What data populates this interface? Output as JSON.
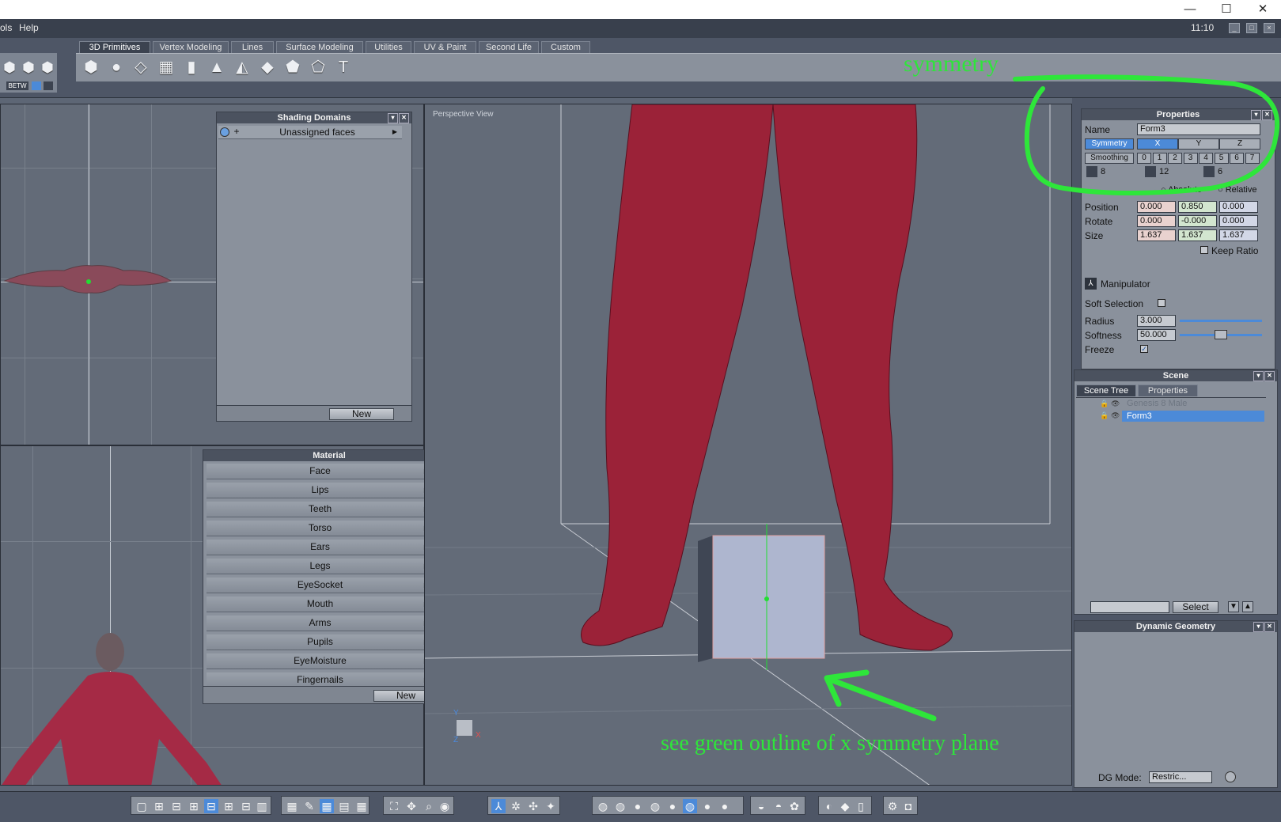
{
  "window": {
    "minimize": "—",
    "maximize": "☐",
    "close": "✕"
  },
  "menubar": {
    "items": [
      "ols",
      "Help"
    ],
    "clock": "11:10"
  },
  "tabs": [
    "3D Primitives",
    "Vertex Modeling",
    "Lines",
    "Surface Modeling",
    "Utilities",
    "UV & Paint",
    "Second Life",
    "Custom"
  ],
  "left_mini": {
    "label": "BETW"
  },
  "shading_domains": {
    "title": "Shading Domains",
    "row": "Unassigned faces",
    "new_button": "New"
  },
  "material": {
    "title": "Material",
    "items": [
      "Face",
      "Lips",
      "Teeth",
      "Torso",
      "Ears",
      "Legs",
      "EyeSocket",
      "Mouth",
      "Arms",
      "Pupils",
      "EyeMoisture",
      "Fingernails"
    ],
    "new_button": "New"
  },
  "viewport": {
    "label": "Perspective View",
    "axis_y": "Y",
    "axis_z": "Z",
    "axis_x": "X"
  },
  "properties": {
    "title": "Properties",
    "name_label": "Name",
    "name_value": "Form3",
    "symmetry_label": "Symmetry",
    "symmetry_axes": [
      "X",
      "Y",
      "Z"
    ],
    "smoothing_label": "Smoothing",
    "smoothing_levels": [
      "0",
      "1",
      "2",
      "3",
      "4",
      "5",
      "6",
      "7"
    ],
    "segments": [
      "8",
      "12",
      "6"
    ],
    "absolute_label": "Absolute",
    "relative_label": "Relative",
    "position_label": "Position",
    "position": [
      "0.000",
      "0.850",
      "0.000"
    ],
    "rotate_label": "Rotate",
    "rotate": [
      "0.000",
      "-0.000",
      "0.000"
    ],
    "size_label": "Size",
    "size": [
      "1.637",
      "1.637",
      "1.637"
    ],
    "keep_ratio_label": "Keep Ratio",
    "manipulator_label": "Manipulator",
    "soft_selection_label": "Soft Selection",
    "radius_label": "Radius",
    "radius_value": "3.000",
    "softness_label": "Softness",
    "softness_value": "50.000",
    "freeze_label": "Freeze"
  },
  "scene": {
    "title": "Scene",
    "tabs": [
      "Scene Tree",
      "Properties"
    ],
    "items": [
      "Genesis 8 Male",
      "Form3"
    ],
    "select_button": "Select"
  },
  "dynamic_geometry": {
    "title": "Dynamic Geometry",
    "dg_mode_label": "DG Mode:",
    "dg_mode_value": "Restric..."
  },
  "annotations": {
    "symmetry": "symmetry",
    "arrow_note": "see green outline of x symmetry plane"
  },
  "colors": {
    "annotation": "#2ee63a",
    "selection": "#4c8ad8",
    "figure": "#9b2238"
  }
}
